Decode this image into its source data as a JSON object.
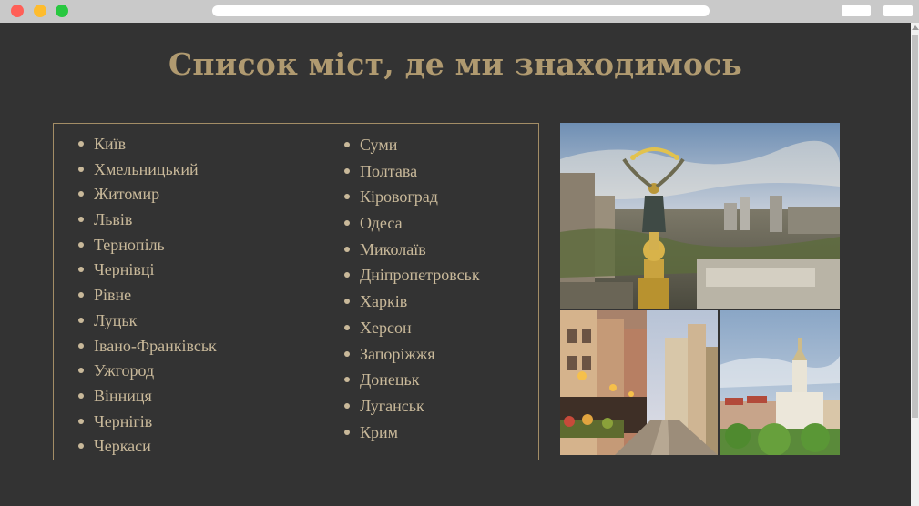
{
  "page": {
    "title": "Список міст, де ми знаходимось"
  },
  "cities": {
    "column1": [
      "Київ",
      "Хмельницький",
      "Житомир",
      "Львів",
      "Тернопіль",
      "Чернівці",
      "Рівне",
      "Луцьк",
      "Івано-Франківськ",
      "Ужгород",
      "Вінниця",
      "Чернігів",
      "Черкаси"
    ],
    "column2": [
      "Суми",
      "Полтава",
      "Кіровоград",
      "Одеса",
      "Миколаїв",
      "Дніпропетровськ",
      "Харків",
      "Херсон",
      "Запоріжжя",
      "Донецьк",
      "Луганськ",
      "Крим"
    ]
  },
  "photos": [
    {
      "name": "kyiv-independence-monument-photo"
    },
    {
      "name": "lviv-street-photo"
    },
    {
      "name": "ivano-frankivsk-city-hall-photo"
    }
  ],
  "colors": {
    "background": "#333333",
    "title": "#b09a70",
    "text": "#c9b99a",
    "border": "#a38d66"
  }
}
